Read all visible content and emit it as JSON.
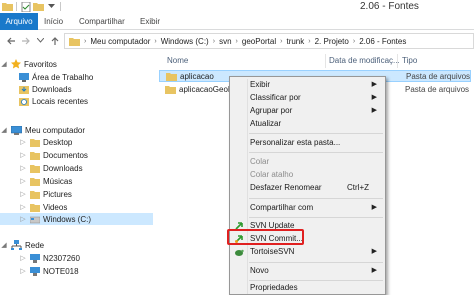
{
  "window": {
    "title": "2.06 - Fontes"
  },
  "ribbon": {
    "tabs": [
      "Arquivo",
      "Início",
      "Compartilhar",
      "Exibir"
    ]
  },
  "address": {
    "crumbs": [
      "Meu computador",
      "Windows (C:)",
      "svn",
      "geoPortal",
      "trunk",
      "2. Projeto",
      "2.06 - Fontes"
    ]
  },
  "nav": {
    "favorites_label": "Favoritos",
    "favorites": [
      "Área de Trabalho",
      "Downloads",
      "Locais recentes"
    ],
    "computer_label": "Meu computador",
    "computer_items": [
      "Desktop",
      "Documentos",
      "Downloads",
      "Músicas",
      "Pictures",
      "Videos",
      "Windows (C:)"
    ],
    "network_label": "Rede",
    "network_items": [
      "N2307260",
      "NOTE018"
    ]
  },
  "columns": {
    "name": "Nome",
    "date": "Data de modificaç...",
    "type": "Tipo"
  },
  "files": [
    {
      "name": "aplicacao",
      "date": "",
      "type": "Pasta de arquivos"
    },
    {
      "name": "aplicacaoGeoPl",
      "date": "",
      "type": "Pasta de arquivos"
    }
  ],
  "menu": {
    "exibir": "Exibir",
    "classificar": "Classificar por",
    "agrupar": "Agrupar por",
    "atualizar": "Atualizar",
    "personalizar": "Personalizar esta pasta...",
    "colar": "Colar",
    "colar_atalho": "Colar atalho",
    "desfazer": "Desfazer Renomear",
    "desfazer_shortcut": "Ctrl+Z",
    "compartilhar": "Compartilhar com",
    "svn_update": "SVN Update",
    "svn_commit": "SVN Commit...",
    "tortoise": "TortoiseSVN",
    "novo": "Novo",
    "propriedades": "Propriedades"
  },
  "colors": {
    "accent": "#1979ca",
    "selection": "#cce8ff",
    "highlight": "#e02020",
    "folder": "#e8c462"
  }
}
